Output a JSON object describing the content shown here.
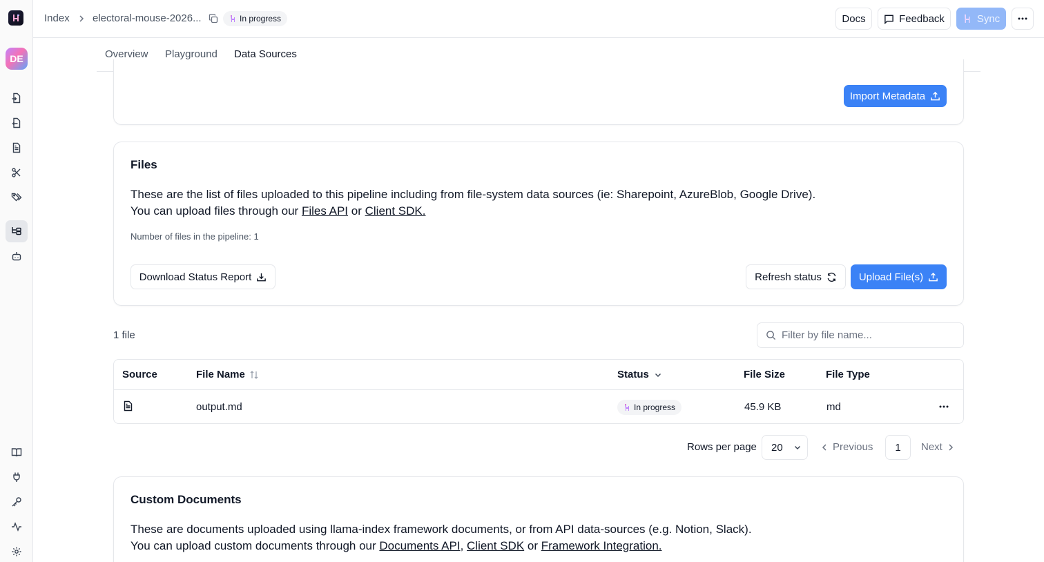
{
  "breadcrumb": {
    "root": "Index",
    "pipeline": "electoral-mouse-2026...",
    "status": "In progress"
  },
  "header": {
    "docs_label": "Docs",
    "feedback_label": "Feedback",
    "sync_label": "Sync"
  },
  "sidebar": {
    "avatar_initials": "DE",
    "items": [
      "file-import-icon",
      "file-export-icon",
      "document-icon",
      "scissors-icon",
      "tags-icon",
      "pipeline-icon",
      "bot-icon",
      "book-icon",
      "plug-icon",
      "key-icon",
      "activity-icon",
      "settings-icon"
    ]
  },
  "tabs": [
    {
      "label": "Overview"
    },
    {
      "label": "Playground"
    },
    {
      "label": "Data Sources",
      "active": true
    }
  ],
  "metadata_card": {
    "import_label": "Import Metadata"
  },
  "files_card": {
    "title": "Files",
    "description_line1": "These are the list of files uploaded to this pipeline including from file-system data sources (ie: Sharepoint, AzureBlob, Google Drive).",
    "description_line2_prefix": "You can upload files through our ",
    "files_api_link": "Files API",
    "or_text": " or ",
    "client_sdk_link": "Client SDK.",
    "file_count_text": "Number of files in the pipeline: 1",
    "download_label": "Download Status Report",
    "refresh_label": "Refresh status",
    "upload_label": "Upload File(s)"
  },
  "file_list": {
    "count_label": "1 file",
    "filter_placeholder": "Filter by file name...",
    "columns": [
      "Source",
      "File Name",
      "Status",
      "File Size",
      "File Type"
    ],
    "rows": [
      {
        "source_icon": "document-icon",
        "file_name": "output.md",
        "status": "In progress",
        "file_size": "45.9 KB",
        "file_type": "md"
      }
    ]
  },
  "pagination": {
    "rows_per_page_label": "Rows per page",
    "rows_per_page_value": "20",
    "previous_label": "Previous",
    "page": "1",
    "next_label": "Next"
  },
  "custom_docs_card": {
    "title": "Custom Documents",
    "description_line1": "These are documents uploaded using llama-index framework documents, or from API data-sources (e.g. Notion, Slack).",
    "description_line2_prefix": "You can upload custom documents through our ",
    "documents_api_link": "Documents API",
    "comma_text": ", ",
    "client_sdk_link": "Client SDK",
    "or_text": " or ",
    "framework_link": "Framework Integration."
  },
  "colors": {
    "accent": "#3b82f6",
    "accent_disabled": "#93b8f8",
    "border": "#e5e7eb"
  }
}
